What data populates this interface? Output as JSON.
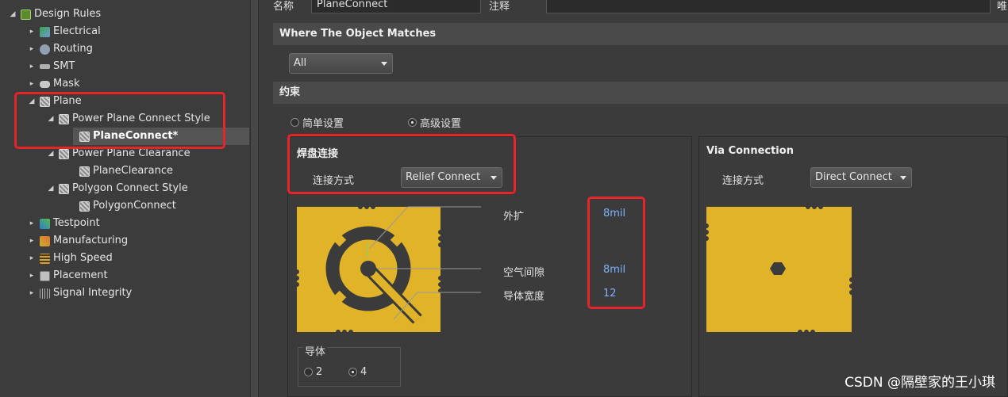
{
  "tree": {
    "root": "Design Rules",
    "items": [
      {
        "label": "Electrical"
      },
      {
        "label": "Routing"
      },
      {
        "label": "SMT"
      },
      {
        "label": "Mask"
      },
      {
        "label": "Plane"
      },
      {
        "label": "Power Plane Connect Style"
      },
      {
        "label": "PlaneConnect*"
      },
      {
        "label": "Power Plane Clearance"
      },
      {
        "label": "PlaneClearance"
      },
      {
        "label": "Polygon Connect Style"
      },
      {
        "label": "PolygonConnect"
      },
      {
        "label": "Testpoint"
      },
      {
        "label": "Manufacturing"
      },
      {
        "label": "High Speed"
      },
      {
        "label": "Placement"
      },
      {
        "label": "Signal Integrity"
      }
    ]
  },
  "header": {
    "name_label": "名称",
    "name_value": "PlaneConnect",
    "comment_label": "注释",
    "comment_value": "",
    "unique_label": "唯"
  },
  "where": {
    "title": "Where The Object Matches",
    "scope_value": "All"
  },
  "constraints": {
    "title": "约束",
    "simple_label": "简单设置",
    "advanced_label": "高级设置",
    "pad": {
      "title": "焊盘连接",
      "connect_label": "连接方式",
      "connect_value": "Relief Connect",
      "expansion_label": "外扩",
      "expansion_value": "8mil",
      "air_gap_label": "空气间隙",
      "air_gap_value": "8mil",
      "conductor_width_label": "导体宽度",
      "conductor_width_value": "12",
      "conductors_label": "导体",
      "conductors_opt1": "2",
      "conductors_opt2": "4"
    },
    "via": {
      "title": "Via Connection",
      "connect_label": "连接方式",
      "connect_value": "Direct Connect"
    }
  },
  "watermark": "CSDN @隔壁家的王小琪",
  "colors": {
    "copper": "#e0b328",
    "cutout": "#3b3b3b",
    "highlight": "#e8232a",
    "value": "#7fb2ff"
  }
}
